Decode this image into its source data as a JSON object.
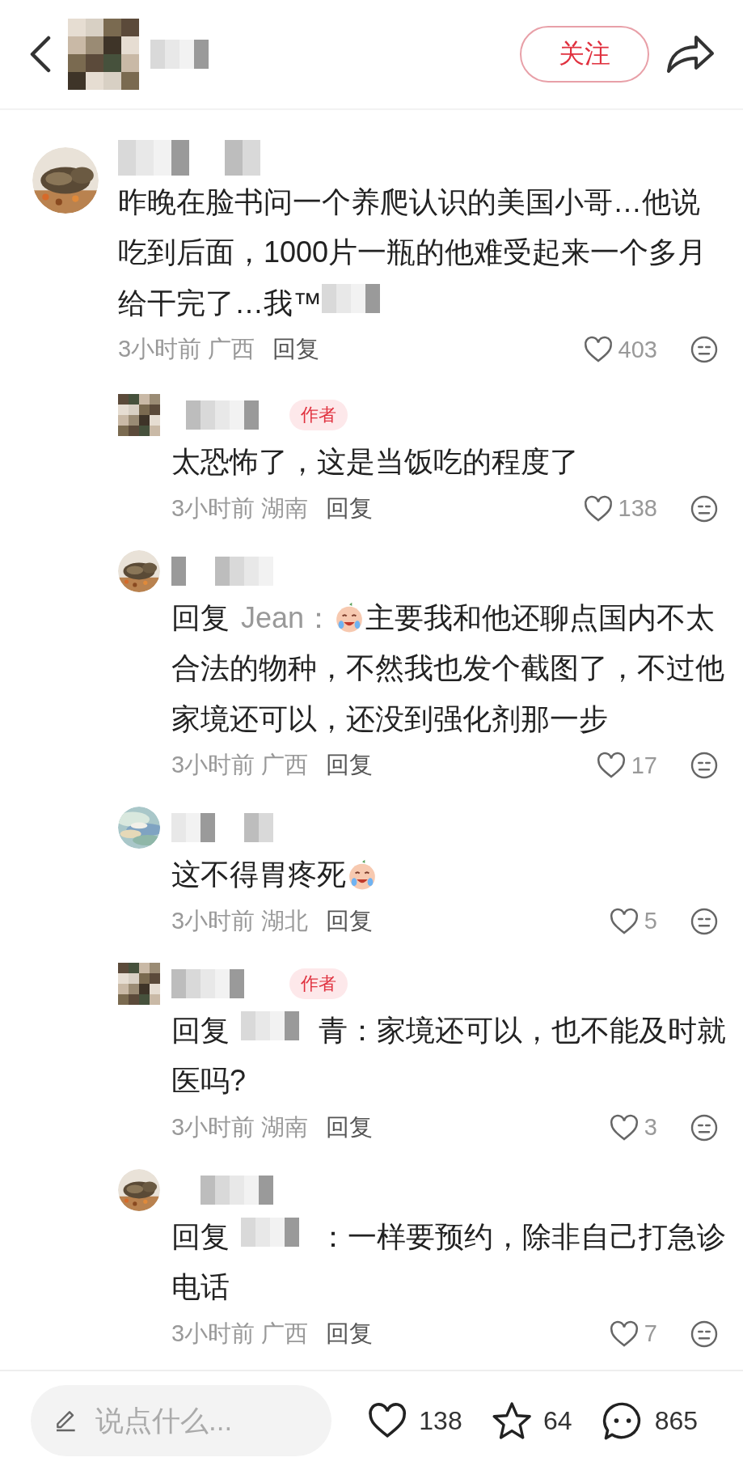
{
  "header": {
    "follow_button": "关注"
  },
  "comments": [
    {
      "body": [
        {
          "kind": "text",
          "text": "昨晚在脸书问一个养爬认识的美国小哥…他说吃到后面，1000片一瓶的他难受起来一个多月给干完了…我™"
        },
        {
          "kind": "redacted"
        }
      ],
      "time": "3小时前",
      "location": "广西",
      "reply": "回复",
      "likes": "403",
      "replies": [
        {
          "badge": "作者",
          "body": [
            {
              "kind": "text",
              "text": "太恐怖了，这是当饭吃的程度了"
            }
          ],
          "time": "3小时前",
          "location": "湖南",
          "reply": "回复",
          "likes": "138"
        },
        {
          "body": [
            {
              "kind": "prefix",
              "text": "回复"
            },
            {
              "kind": "mention",
              "text": "Jean："
            },
            {
              "kind": "emoji"
            },
            {
              "kind": "text",
              "text": "主要我和他还聊点国内不太合法的物种，不然我也发个截图了，不过他家境还可以，还没到强化剂那一步"
            }
          ],
          "time": "3小时前",
          "location": "广西",
          "reply": "回复",
          "likes": "17"
        },
        {
          "body": [
            {
              "kind": "text",
              "text": "这不得胃疼死"
            },
            {
              "kind": "emoji"
            }
          ],
          "time": "3小时前",
          "location": "湖北",
          "reply": "回复",
          "likes": "5"
        },
        {
          "badge": "作者",
          "body": [
            {
              "kind": "prefix",
              "text": "回复"
            },
            {
              "kind": "redacted"
            },
            {
              "kind": "text",
              "text": "青：家境还可以，也不能及时就医吗?"
            }
          ],
          "time": "3小时前",
          "location": "湖南",
          "reply": "回复",
          "likes": "3"
        },
        {
          "body": [
            {
              "kind": "prefix",
              "text": "回复"
            },
            {
              "kind": "redacted"
            },
            {
              "kind": "text",
              "text": "：一样要预约，除非自己打急诊电话"
            }
          ],
          "time": "3小时前",
          "location": "广西",
          "reply": "回复",
          "likes": "7"
        }
      ]
    }
  ],
  "bottom_bar": {
    "placeholder": "说点什么...",
    "likes": "138",
    "favorites": "64",
    "comments": "865"
  }
}
